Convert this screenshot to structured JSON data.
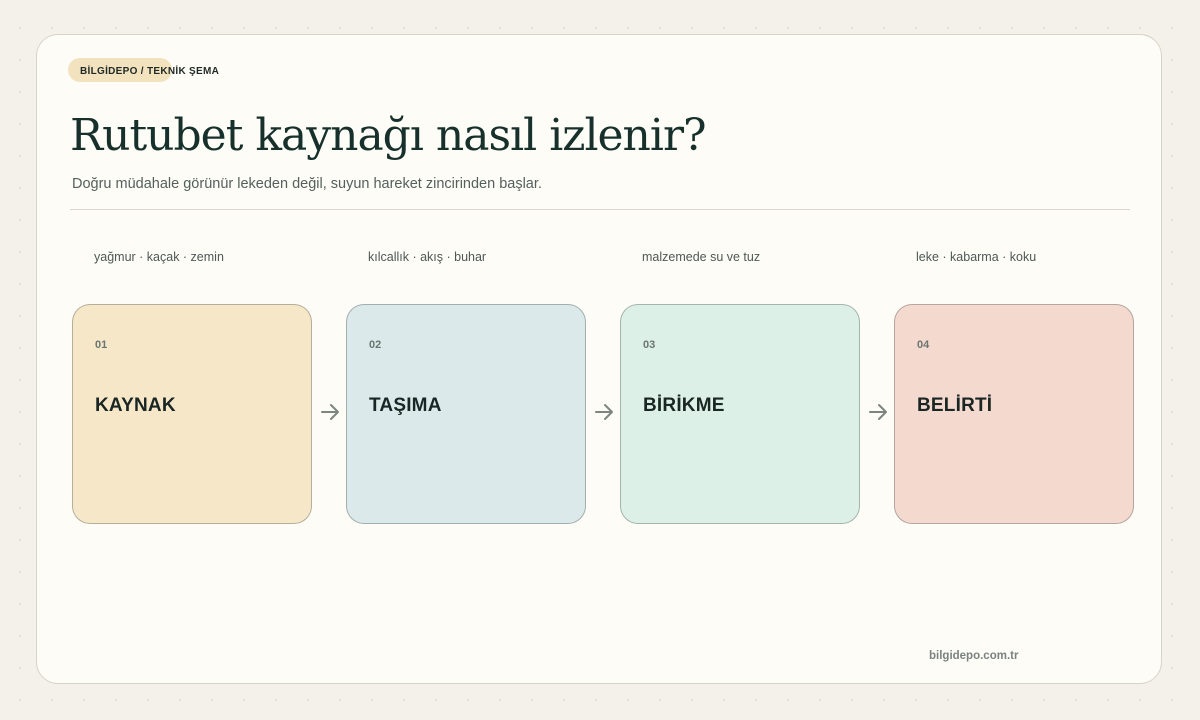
{
  "header": {
    "badge": "BİLGİDEPO / TEKNİK ŞEMA",
    "title": "Rutubet kaynağı nasıl izlenir?",
    "subtitle": "Doğru müdahale görünür lekeden değil, suyun hareket zincirinden başlar."
  },
  "steps": [
    {
      "number": "01",
      "label": "KAYNAK",
      "tags": "yağmur · kaçak · zemin",
      "color": "#f6e7c9"
    },
    {
      "number": "02",
      "label": "TAŞIMA",
      "tags": "kılcallık · akış · buhar",
      "color": "#dbe9ea"
    },
    {
      "number": "03",
      "label": "BİRİKME",
      "tags": "malzemede su ve tuz",
      "color": "#dcf0e8"
    },
    {
      "number": "04",
      "label": "BELİRTİ",
      "tags": "leke · kabarma · koku",
      "color": "#f4d9cf"
    }
  ],
  "arrow_icon": "arrow-right-icon",
  "footer": {
    "site": "bilgidepo.com.tr"
  }
}
